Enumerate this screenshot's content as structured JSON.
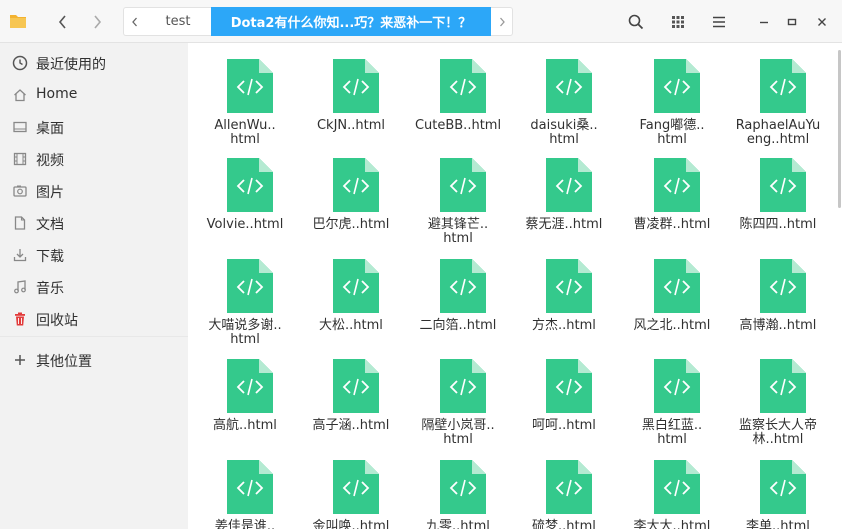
{
  "toolbar": {
    "breadcrumbs": [
      "test",
      "Dota2有什么你知...巧？来恶补一下！？"
    ]
  },
  "sidebar": {
    "items": [
      {
        "label": "最近使用的",
        "icon": "clock-icon"
      },
      {
        "label": "Home",
        "icon": "home-icon"
      },
      {
        "label": "桌面",
        "icon": "desktop-icon"
      },
      {
        "label": "视频",
        "icon": "video-icon"
      },
      {
        "label": "图片",
        "icon": "image-icon"
      },
      {
        "label": "文档",
        "icon": "document-icon"
      },
      {
        "label": "下载",
        "icon": "download-icon"
      },
      {
        "label": "音乐",
        "icon": "music-icon"
      },
      {
        "label": "回收站",
        "icon": "trash-icon"
      },
      {
        "label": "其他位置",
        "icon": "plus-icon"
      }
    ]
  },
  "files": {
    "icon": "html-file-icon",
    "names": [
      [
        "AllenWu..",
        "html"
      ],
      [
        "CkJN..html"
      ],
      [
        "CuteBB..html"
      ],
      [
        "daisuki桑..",
        "html"
      ],
      [
        "Fang嘟德..",
        "html"
      ],
      [
        "RaphaelAuYu",
        "eng..html"
      ],
      [
        "Volvie..html"
      ],
      [
        "巴尔虎..html"
      ],
      [
        "避其锋芒..",
        "html"
      ],
      [
        "蔡无涯..html"
      ],
      [
        "曹凌群..html"
      ],
      [
        "陈四四..html"
      ],
      [
        "大喵说多谢..",
        "html"
      ],
      [
        "大松..html"
      ],
      [
        "二向箔..html"
      ],
      [
        "方杰..html"
      ],
      [
        "风之北..html"
      ],
      [
        "高博瀚..html"
      ],
      [
        "高航..html"
      ],
      [
        "高子涵..html"
      ],
      [
        "隔壁小岚哥..",
        "html"
      ],
      [
        "呵呵..html"
      ],
      [
        "黑白红蓝..",
        "html"
      ],
      [
        "监察长大人帝",
        "林..html"
      ],
      [
        "姜佳是谁.."
      ],
      [
        "金叫唤..html"
      ],
      [
        "九零..html"
      ],
      [
        "硫梦..html"
      ],
      [
        "李大大..html"
      ],
      [
        "李单..html"
      ]
    ]
  }
}
